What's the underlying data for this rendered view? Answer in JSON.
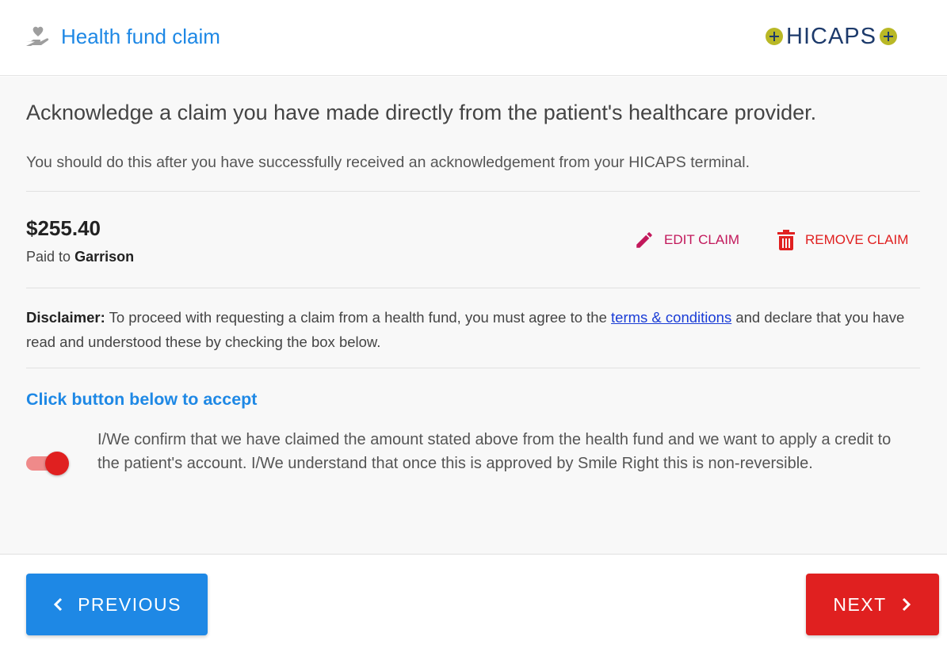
{
  "header": {
    "title": "Health fund claim",
    "icon": "hand-heart-icon",
    "logo_text": "HICAPS"
  },
  "intro": {
    "title": "Acknowledge a claim you have made directly from the patient's healthcare provider.",
    "subtitle": "You should do this after you have successfully received an acknowledgement from your HICAPS terminal."
  },
  "claim": {
    "amount": "$255.40",
    "paid_to_label": "Paid to",
    "payee": "Garrison",
    "edit_label": "EDIT CLAIM",
    "remove_label": "REMOVE CLAIM"
  },
  "disclaimer": {
    "label": "Disclaimer:",
    "text_before": "To proceed with requesting a claim from a health fund, you must agree to the",
    "link_text": "terms & conditions",
    "text_after": "and declare that you have read and understood these by checking the box below."
  },
  "accept": {
    "title": "Click button below to accept",
    "confirm_text": "I/We confirm that we have claimed the amount stated above from the health fund and we want to apply a credit to the patient's account. I/We understand that once this is approved by Smile Right this is non-reversible.",
    "toggle_on": true
  },
  "footer": {
    "previous_label": "PREVIOUS",
    "next_label": "NEXT"
  },
  "colors": {
    "primary_blue": "#1e88e5",
    "danger_red": "#e02020",
    "edit_magenta": "#c2185b",
    "logo_navy": "#1d3a6b",
    "logo_olive": "#b9b826"
  }
}
